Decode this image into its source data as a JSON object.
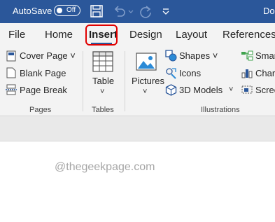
{
  "titlebar": {
    "autosave_label": "AutoSave",
    "autosave_state": "Off",
    "doc_title": "Do"
  },
  "tabs": [
    {
      "label": "File"
    },
    {
      "label": "Home"
    },
    {
      "label": "Insert",
      "active": true
    },
    {
      "label": "Design"
    },
    {
      "label": "Layout"
    },
    {
      "label": "References"
    }
  ],
  "ribbon": {
    "pages": {
      "items": [
        "Cover Page ˅",
        "Blank Page",
        "Page Break"
      ],
      "group_label": "Pages"
    },
    "tables": {
      "table_label": "Table",
      "table_chevron": "˅",
      "group_label": "Tables"
    },
    "illustrations": {
      "pictures_label": "Pictures",
      "pictures_chevron": "˅",
      "shapes_label": "Shapes ˅",
      "icons_label": "Icons",
      "models_label": "3D Models",
      "models_chevron": "˅",
      "group_label": "Illustrations",
      "smartart_partial": "Smar",
      "chart_partial": "Chart",
      "screenshot_partial": "Scree"
    }
  },
  "document": {
    "watermark": "@thegeekpage.com"
  },
  "colors": {
    "titlebar": "#2b579a",
    "highlight": "#e00000",
    "ribbon": "#f3f3f3"
  },
  "icons": {
    "save": "save-icon",
    "undo": "undo-icon",
    "redo": "redo-icon",
    "customize": "customize-qat-icon"
  }
}
